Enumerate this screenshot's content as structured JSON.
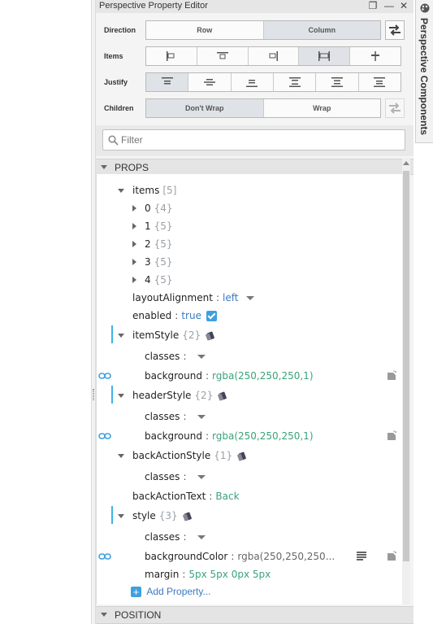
{
  "panel": {
    "title": "Perspective Property Editor",
    "window_buttons": {
      "restore": "❐",
      "minimize": "—",
      "close": "✕"
    }
  },
  "direction": {
    "label": "Direction",
    "options": [
      "Row",
      "Column"
    ],
    "selected": "Column"
  },
  "items": {
    "label": "Items",
    "selected_index": 3
  },
  "justify": {
    "label": "Justify",
    "selected_index": 0
  },
  "children": {
    "label": "Children",
    "options": [
      "Don't Wrap",
      "Wrap"
    ],
    "selected": "Don't Wrap"
  },
  "filter": {
    "placeholder": "Filter"
  },
  "props": {
    "header": "PROPS",
    "items_key": "items",
    "items_count": "[5]",
    "item_nodes": [
      {
        "key": "0",
        "count": "{4}"
      },
      {
        "key": "1",
        "count": "{5}"
      },
      {
        "key": "2",
        "count": "{5}"
      },
      {
        "key": "3",
        "count": "{5}"
      },
      {
        "key": "4",
        "count": "{5}"
      }
    ],
    "layoutAlignment": {
      "key": "layoutAlignment",
      "value": "left"
    },
    "enabled": {
      "key": "enabled",
      "value": "true"
    },
    "itemStyle": {
      "key": "itemStyle",
      "count": "{2}",
      "classes": "classes",
      "background_key": "background",
      "background": "rgba(250,250,250,1)"
    },
    "headerStyle": {
      "key": "headerStyle",
      "count": "{2}",
      "classes": "classes",
      "background_key": "background",
      "background": "rgba(250,250,250,1)"
    },
    "backActionStyle": {
      "key": "backActionStyle",
      "count": "{1}",
      "classes": "classes"
    },
    "backActionText": {
      "key": "backActionText",
      "value": "Back"
    },
    "style": {
      "key": "style",
      "count": "{3}",
      "classes": "classes",
      "bg_key": "backgroundColor",
      "bg_value": "rgba(250,250,250...",
      "margin_key": "margin",
      "margin_value": "5px 5px 0px 5px"
    },
    "add_property": "Add Property..."
  },
  "position": {
    "header": "POSITION"
  },
  "side_tab": {
    "label": "Perspective Components"
  },
  "colors": {
    "accent": "#3fb3e8",
    "value_green": "#3aa37a",
    "value_blue": "#3a7ac2"
  }
}
